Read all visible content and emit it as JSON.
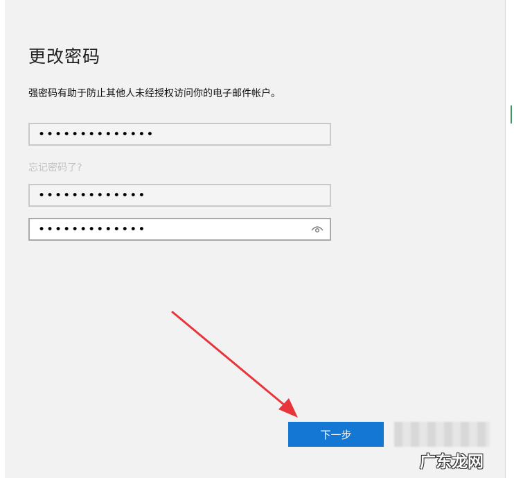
{
  "dialog": {
    "title": "更改密码",
    "description": "强密码有助于防止其他人未经授权访问你的电子邮件帐户。"
  },
  "fields": {
    "current_password": "••••••••••••••",
    "forgot_link": "忘记密码了?",
    "new_password": "•••••••••••••",
    "confirm_password": "•••••••••••••"
  },
  "icons": {
    "reveal": "eye-icon"
  },
  "buttons": {
    "next": "下一步"
  },
  "watermark": "广东龙网",
  "colors": {
    "background": "#f2f2f2",
    "primary_button": "#1477d4",
    "arrow": "#e8353c",
    "link_disabled": "#c2c2c2"
  }
}
